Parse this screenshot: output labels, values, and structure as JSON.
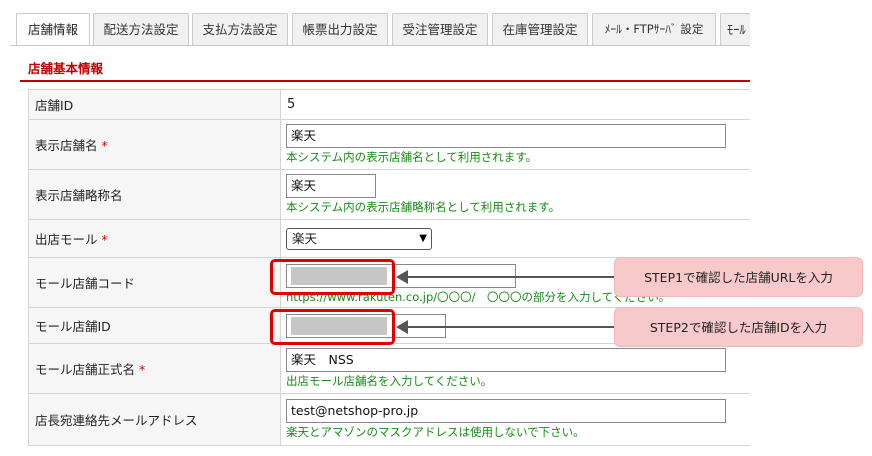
{
  "tabs": [
    {
      "label": "店舗情報",
      "active": true
    },
    {
      "label": "配送方法設定"
    },
    {
      "label": "支払方法設定"
    },
    {
      "label": "帳票出力設定"
    },
    {
      "label": "受注管理設定"
    },
    {
      "label": "在庫管理設定"
    },
    {
      "label": "ﾒｰﾙ・FTPｻｰﾊﾞ 設定"
    },
    {
      "label": "ﾓｰﾙ"
    }
  ],
  "section": {
    "title": "店舗基本情報"
  },
  "required_mark": "*",
  "rows": {
    "shop_id": {
      "label": "店舗ID",
      "value": "5"
    },
    "display_name": {
      "label": "表示店舗名",
      "value": "楽天",
      "hint": "本システム内の表示店舗名として利用されます。"
    },
    "short_name": {
      "label": "表示店舗略称名",
      "value": "楽天",
      "hint": "本システム内の表示店舗略称名として利用されます。"
    },
    "mall": {
      "label": "出店モール",
      "selected": "楽天"
    },
    "mall_shop_code": {
      "label": "モール店舗コード",
      "hint": "https://www.rakuten.co.jp/〇〇〇/　〇〇〇の部分を入力してください。"
    },
    "mall_shop_id": {
      "label": "モール店舗ID"
    },
    "official_name": {
      "label": "モール店舗正式名",
      "value": "楽天　NSS",
      "hint": "出店モール店舗名を入力してください。"
    },
    "manager_email": {
      "label": "店長宛連絡先メールアドレス",
      "value": "test@netshop-pro.jp",
      "hint": "楽天とアマゾンのマスクアドレスは使用しないで下さい。"
    }
  },
  "annotations": {
    "step1": "STEP1で確認した店舗URLを入力",
    "step2": "STEP2で確認した店舗IDを入力"
  },
  "colors": {
    "accent": "#c00000",
    "hint": "#1a8a1a",
    "callout": "#f7c9cb",
    "highlight": "#e00000"
  }
}
